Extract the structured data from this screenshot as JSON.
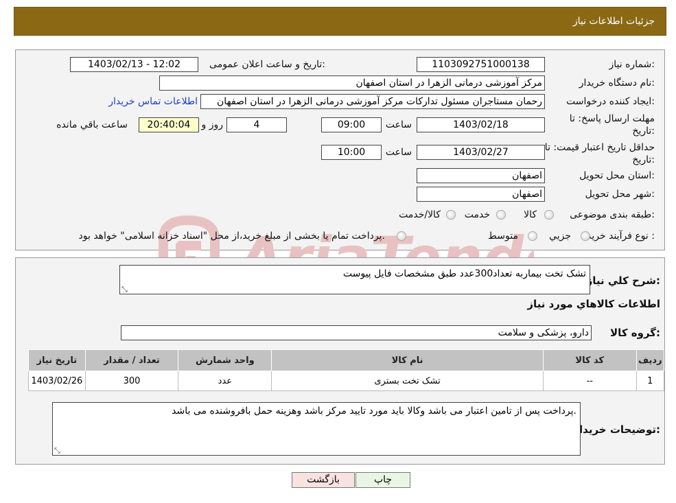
{
  "header": {
    "title": "جزئیات اطلاعات نیاز"
  },
  "details": {
    "need_number_label": "شماره نیاز:",
    "need_number": "1103092751000138",
    "announce_label": "تاریخ و ساعت اعلان عمومی:",
    "announce_value": "1403/02/13 - 12:02",
    "buyer_org_label": "نام دستگاه خریدار:",
    "buyer_org": "مرکز آموزشی درمانی الزهرا در استان اصفهان",
    "creator_label": "ایجاد کننده درخواست:",
    "creator": "رحمان مستاجران مسئول تدارکات مرکز آموزشی درمانی الزهرا در استان اصفهان",
    "contact_link": "اطلاعات تماس خریدار",
    "reply_deadline_label_1": "مهلت ارسال پاسخ: تا",
    "reply_deadline_label_2": "تاریخ:",
    "reply_date": "1403/02/18",
    "time_label": "ساعت",
    "reply_time": "09:00",
    "days_value": "4",
    "days_label": "روز و",
    "remaining_time": "20:40:04",
    "remaining_label": "ساعت باقي مانده",
    "price_validity_label_1": "حداقل تاریخ اعتبار قیمت: تا",
    "price_validity_label_2": "تاریخ:",
    "price_validity_date": "1403/02/27",
    "price_validity_time": "10:00",
    "province_label": "استان محل تحویل:",
    "province": "اصفهان",
    "city_label": "شهر محل تحویل:",
    "city": "اصفهان",
    "category_label": "طبقه بندی موضوعی:",
    "category_options": [
      "کالا",
      "خدمت",
      "کالا/خدمت"
    ],
    "purchase_type_label": "نوع فرآیند خرید :",
    "purchase_options": [
      "جزیي",
      "متوسط"
    ],
    "payment_note": "پرداخت تمام یا بخشی از مبلغ خرید،از محل \"اسناد خزانه اسلامی\" خواهد بود."
  },
  "watermark": {
    "text": "AriaTender.neT",
    "color": "#e8c2c2"
  },
  "summary": {
    "label": "شرح کلي نياز:",
    "value": "تشک تخت بیماربه تعداد300عدد طبق مشخصات فایل پیوست",
    "goods_section_title": "اطلاعات کالاهاي مورد نياز",
    "group_label": "گروه کالا:",
    "group_value": "دارو، پزشکی و سلامت"
  },
  "table": {
    "headers": [
      "رديف",
      "کد کالا",
      "نام کالا",
      "واحد شمارش",
      "تعداد / مقدار",
      "تاريخ نياز"
    ],
    "rows": [
      [
        "1",
        "--",
        "تشک تخت بستری",
        "عدد",
        "300",
        "1403/02/26"
      ]
    ]
  },
  "buyer_notes": {
    "label": "توضیحات خریدار:",
    "value": "پرداخت پس از تامین اعتبار می باشد وکالا باید مورد تایید مرکز باشد وهزینه حمل بافروشنده می باشد."
  },
  "buttons": {
    "print": "چاپ",
    "back": "بازگشت"
  }
}
